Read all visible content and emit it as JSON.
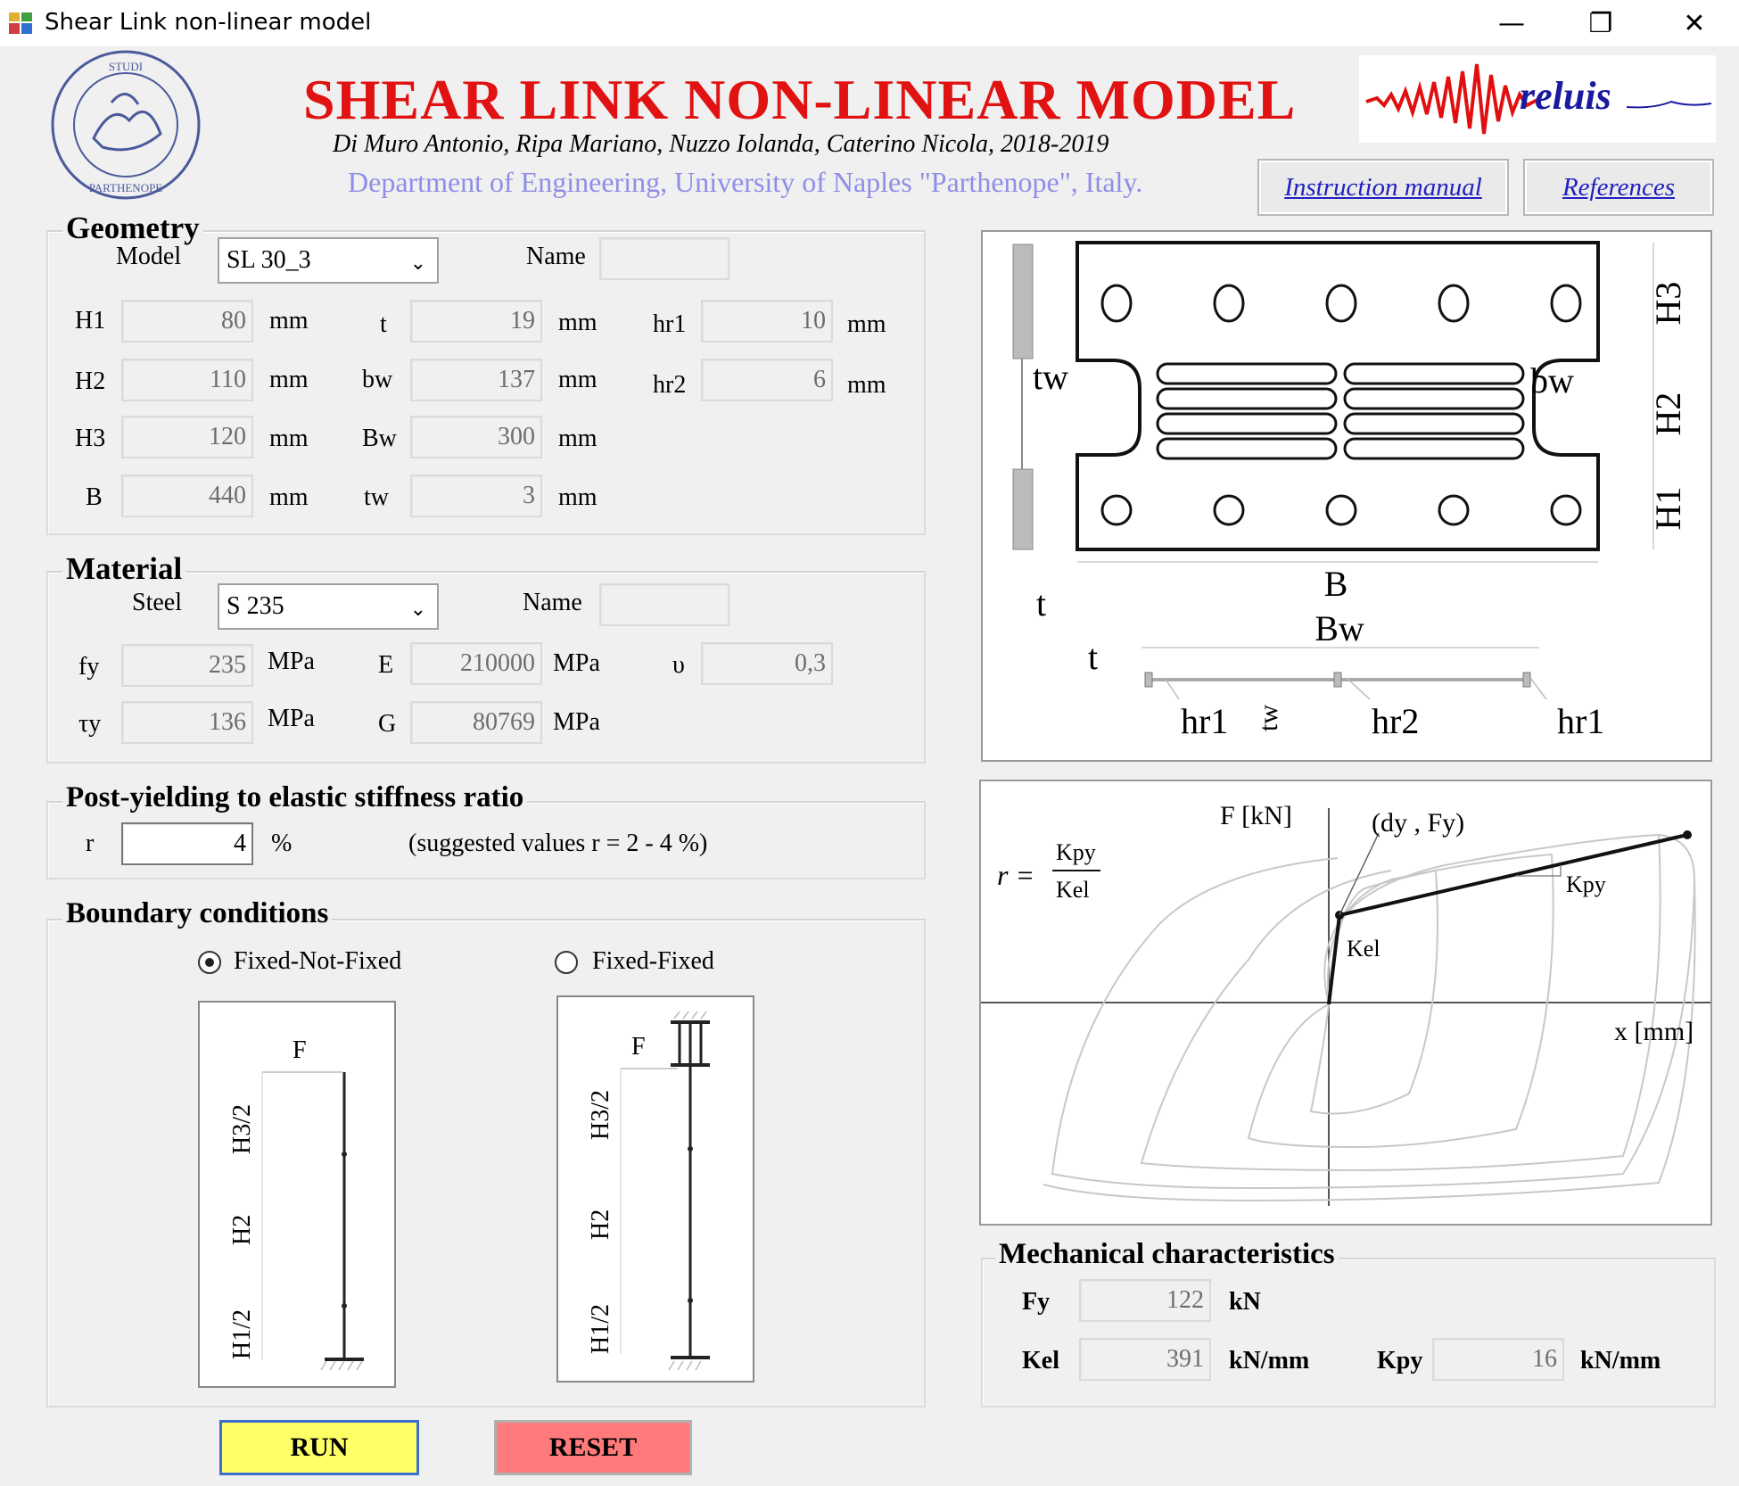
{
  "window": {
    "title": "Shear Link non-linear model",
    "min": "—",
    "restore": "❐",
    "close": "✕"
  },
  "header": {
    "title": "SHEAR LINK NON-LINEAR MODEL",
    "authors": "Di Muro Antonio, Ripa Mariano, Nuzzo Iolanda, Caterino Nicola, 2018-2019",
    "department": "Department of Engineering, University of Naples \"Parthenope\", Italy.",
    "logo_text": "reluis",
    "seal_text": "UNIVERSITAS PARTHENOPE",
    "manual": "Instruction manual",
    "references": "References"
  },
  "geometry": {
    "title": "Geometry",
    "model_label": "Model",
    "model_value": "SL 30_3",
    "name_label": "Name",
    "name_value": "",
    "rows": [
      {
        "l1": "H1",
        "v1": "80",
        "u1": "mm",
        "l2": "t",
        "v2": "19",
        "u2": "mm",
        "l3": "hr1",
        "v3": "10",
        "u3": "mm"
      },
      {
        "l1": "H2",
        "v1": "110",
        "u1": "mm",
        "l2": "bw",
        "v2": "137",
        "u2": "mm",
        "l3": "hr2",
        "v3": "6",
        "u3": "mm"
      },
      {
        "l1": "H3",
        "v1": "120",
        "u1": "mm",
        "l2": "Bw",
        "v2": "300",
        "u2": "mm"
      },
      {
        "l1": "B",
        "v1": "440",
        "u1": "mm",
        "l2": "tw",
        "v2": "3",
        "u2": "mm"
      }
    ]
  },
  "material": {
    "title": "Material",
    "steel_label": "Steel",
    "steel_value": "S 235",
    "name_label": "Name",
    "name_value": "",
    "fy_label": "fy",
    "fy": "235",
    "fy_unit": "MPa",
    "E_label": "E",
    "E": "210000",
    "E_unit": "MPa",
    "nu_label": "υ",
    "nu": "0,3",
    "ty_label": "τy",
    "ty": "136",
    "ty_unit": "MPa",
    "G_label": "G",
    "G": "80769",
    "G_unit": "MPa"
  },
  "post": {
    "title": "Post-yielding to elastic stiffness ratio",
    "r_label": "r",
    "r": "4",
    "unit": "%",
    "hint": "(suggested values r = 2 - 4 %)"
  },
  "boundary": {
    "title": "Boundary conditions",
    "opt1": "Fixed-Not-Fixed",
    "opt2": "Fixed-Fixed",
    "selected": "Fixed-Not-Fixed",
    "F": "F",
    "h3": "H3/2",
    "h2": "H2",
    "h1": "H1/2"
  },
  "drawing": {
    "H3": "H3",
    "H2": "H2",
    "H1": "H1",
    "B": "B",
    "Bw": "Bw",
    "t": "t",
    "tw": "tw",
    "bw": "bw",
    "hr1": "hr1",
    "hr2": "hr2"
  },
  "graph": {
    "F": "F [kN]",
    "x": "x [mm]",
    "dyfy": "(dy , Fy)",
    "kpy": "Kpy",
    "kel": "Kel",
    "r": "r ="
  },
  "mech": {
    "title": "Mechanical characteristics",
    "fy_label": "Fy",
    "fy": "122",
    "fy_unit": "kN",
    "kel_label": "Kel",
    "kel": "391",
    "kel_unit": "kN/mm",
    "kpy_label": "Kpy",
    "kpy": "16",
    "kpy_unit": "kN/mm"
  },
  "buttons": {
    "run": "RUN",
    "reset": "RESET",
    "run_color": "#ffff66",
    "reset_color": "#ff7a7a"
  }
}
